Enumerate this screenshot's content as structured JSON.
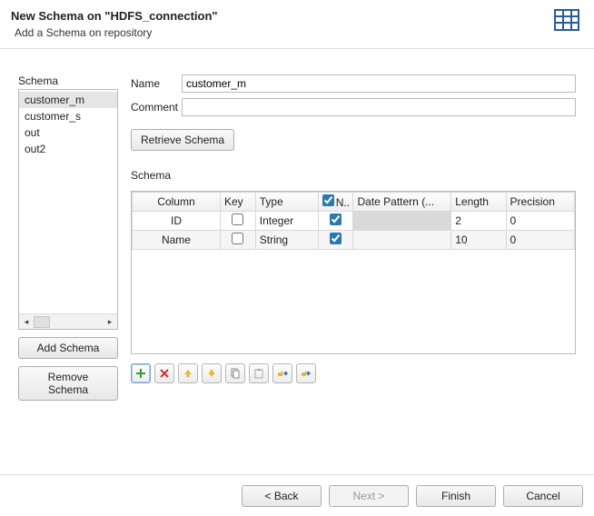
{
  "header": {
    "title": "New Schema on \"HDFS_connection\"",
    "subtitle": "Add a Schema on repository"
  },
  "left": {
    "label": "Schema",
    "items": [
      "customer_m",
      "customer_s",
      "out",
      "out2"
    ],
    "selected_index": 0,
    "add_label": "Add Schema",
    "remove_label": "Remove Schema"
  },
  "form": {
    "name_label": "Name",
    "name_value": "customer_m",
    "comment_label": "Comment",
    "comment_value": "",
    "retrieve_label": "Retrieve Schema"
  },
  "schema_section": {
    "label": "Schema",
    "columns": {
      "column": "Column",
      "key": "Key",
      "type": "Type",
      "nullable": "N..",
      "date_pattern": "Date Pattern (...",
      "length": "Length",
      "precision": "Precision"
    },
    "rows": [
      {
        "column": "ID",
        "key": false,
        "type": "Integer",
        "nullable": true,
        "date_pattern": "",
        "length": "2",
        "precision": "0",
        "dp_shaded": true
      },
      {
        "column": "Name",
        "key": false,
        "type": "String",
        "nullable": true,
        "date_pattern": "",
        "length": "10",
        "precision": "0",
        "dp_shaded": false
      }
    ]
  },
  "toolbar": {
    "icons": [
      "add-icon",
      "delete-icon",
      "move-up-icon",
      "move-down-icon",
      "copy-icon",
      "paste-icon",
      "import-icon",
      "export-icon"
    ]
  },
  "footer": {
    "back": "< Back",
    "next": "Next >",
    "finish": "Finish",
    "cancel": "Cancel"
  }
}
